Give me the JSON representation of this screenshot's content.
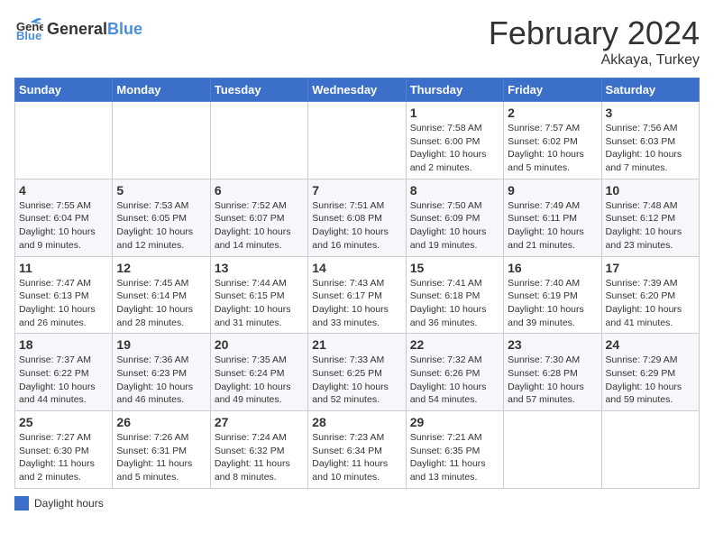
{
  "header": {
    "logo_general": "General",
    "logo_blue": "Blue",
    "title": "February 2024",
    "location": "Akkaya, Turkey"
  },
  "columns": [
    "Sunday",
    "Monday",
    "Tuesday",
    "Wednesday",
    "Thursday",
    "Friday",
    "Saturday"
  ],
  "weeks": [
    {
      "days": [
        {
          "num": "",
          "info": ""
        },
        {
          "num": "",
          "info": ""
        },
        {
          "num": "",
          "info": ""
        },
        {
          "num": "",
          "info": ""
        },
        {
          "num": "1",
          "info": "Sunrise: 7:58 AM\nSunset: 6:00 PM\nDaylight: 10 hours and 2 minutes."
        },
        {
          "num": "2",
          "info": "Sunrise: 7:57 AM\nSunset: 6:02 PM\nDaylight: 10 hours and 5 minutes."
        },
        {
          "num": "3",
          "info": "Sunrise: 7:56 AM\nSunset: 6:03 PM\nDaylight: 10 hours and 7 minutes."
        }
      ]
    },
    {
      "days": [
        {
          "num": "4",
          "info": "Sunrise: 7:55 AM\nSunset: 6:04 PM\nDaylight: 10 hours and 9 minutes."
        },
        {
          "num": "5",
          "info": "Sunrise: 7:53 AM\nSunset: 6:05 PM\nDaylight: 10 hours and 12 minutes."
        },
        {
          "num": "6",
          "info": "Sunrise: 7:52 AM\nSunset: 6:07 PM\nDaylight: 10 hours and 14 minutes."
        },
        {
          "num": "7",
          "info": "Sunrise: 7:51 AM\nSunset: 6:08 PM\nDaylight: 10 hours and 16 minutes."
        },
        {
          "num": "8",
          "info": "Sunrise: 7:50 AM\nSunset: 6:09 PM\nDaylight: 10 hours and 19 minutes."
        },
        {
          "num": "9",
          "info": "Sunrise: 7:49 AM\nSunset: 6:11 PM\nDaylight: 10 hours and 21 minutes."
        },
        {
          "num": "10",
          "info": "Sunrise: 7:48 AM\nSunset: 6:12 PM\nDaylight: 10 hours and 23 minutes."
        }
      ]
    },
    {
      "days": [
        {
          "num": "11",
          "info": "Sunrise: 7:47 AM\nSunset: 6:13 PM\nDaylight: 10 hours and 26 minutes."
        },
        {
          "num": "12",
          "info": "Sunrise: 7:45 AM\nSunset: 6:14 PM\nDaylight: 10 hours and 28 minutes."
        },
        {
          "num": "13",
          "info": "Sunrise: 7:44 AM\nSunset: 6:15 PM\nDaylight: 10 hours and 31 minutes."
        },
        {
          "num": "14",
          "info": "Sunrise: 7:43 AM\nSunset: 6:17 PM\nDaylight: 10 hours and 33 minutes."
        },
        {
          "num": "15",
          "info": "Sunrise: 7:41 AM\nSunset: 6:18 PM\nDaylight: 10 hours and 36 minutes."
        },
        {
          "num": "16",
          "info": "Sunrise: 7:40 AM\nSunset: 6:19 PM\nDaylight: 10 hours and 39 minutes."
        },
        {
          "num": "17",
          "info": "Sunrise: 7:39 AM\nSunset: 6:20 PM\nDaylight: 10 hours and 41 minutes."
        }
      ]
    },
    {
      "days": [
        {
          "num": "18",
          "info": "Sunrise: 7:37 AM\nSunset: 6:22 PM\nDaylight: 10 hours and 44 minutes."
        },
        {
          "num": "19",
          "info": "Sunrise: 7:36 AM\nSunset: 6:23 PM\nDaylight: 10 hours and 46 minutes."
        },
        {
          "num": "20",
          "info": "Sunrise: 7:35 AM\nSunset: 6:24 PM\nDaylight: 10 hours and 49 minutes."
        },
        {
          "num": "21",
          "info": "Sunrise: 7:33 AM\nSunset: 6:25 PM\nDaylight: 10 hours and 52 minutes."
        },
        {
          "num": "22",
          "info": "Sunrise: 7:32 AM\nSunset: 6:26 PM\nDaylight: 10 hours and 54 minutes."
        },
        {
          "num": "23",
          "info": "Sunrise: 7:30 AM\nSunset: 6:28 PM\nDaylight: 10 hours and 57 minutes."
        },
        {
          "num": "24",
          "info": "Sunrise: 7:29 AM\nSunset: 6:29 PM\nDaylight: 10 hours and 59 minutes."
        }
      ]
    },
    {
      "days": [
        {
          "num": "25",
          "info": "Sunrise: 7:27 AM\nSunset: 6:30 PM\nDaylight: 11 hours and 2 minutes."
        },
        {
          "num": "26",
          "info": "Sunrise: 7:26 AM\nSunset: 6:31 PM\nDaylight: 11 hours and 5 minutes."
        },
        {
          "num": "27",
          "info": "Sunrise: 7:24 AM\nSunset: 6:32 PM\nDaylight: 11 hours and 8 minutes."
        },
        {
          "num": "28",
          "info": "Sunrise: 7:23 AM\nSunset: 6:34 PM\nDaylight: 11 hours and 10 minutes."
        },
        {
          "num": "29",
          "info": "Sunrise: 7:21 AM\nSunset: 6:35 PM\nDaylight: 11 hours and 13 minutes."
        },
        {
          "num": "",
          "info": ""
        },
        {
          "num": "",
          "info": ""
        }
      ]
    }
  ],
  "legend": {
    "box_label": "Daylight hours"
  }
}
